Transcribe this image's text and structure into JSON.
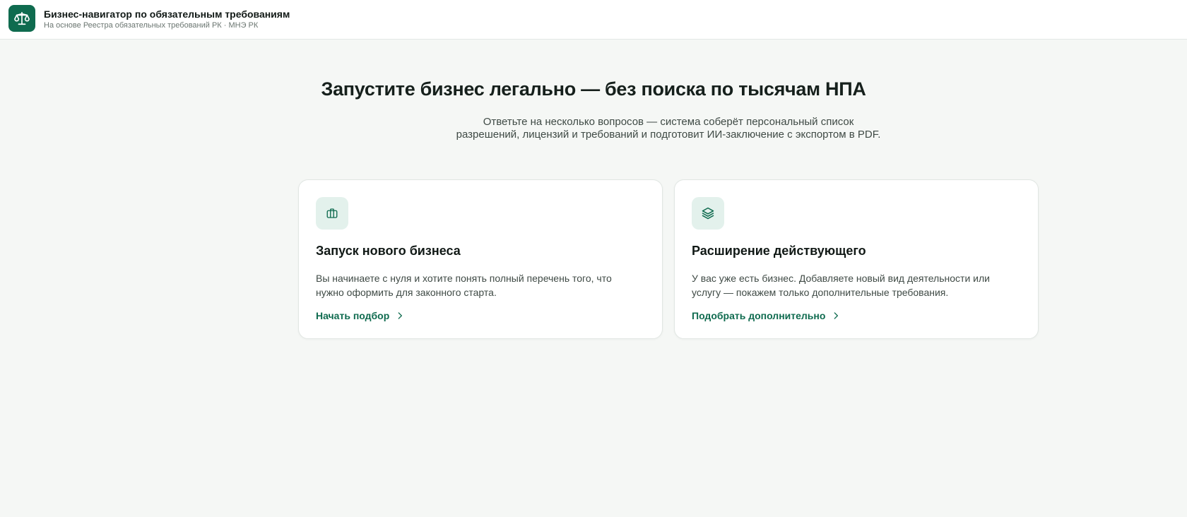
{
  "header": {
    "logo_icon": "scales-icon",
    "title": "Бизнес-навигатор по обязательным требованиям",
    "subtitle": "На основе Реестра обязательных требований РК · МНЭ РК"
  },
  "hero": {
    "title": "Запустите бизнес легально — без поиска по тысячам НПА",
    "text": "Ответьте на несколько вопросов — система соберёт персональный список разрешений, лицензий и требований и подготовит ИИ-заключение с экспортом в PDF."
  },
  "cards": [
    {
      "icon": "briefcase-icon",
      "title": "Запуск нового бизнеса",
      "description": "Вы начинаете с нуля и хотите понять полный перечень того, что нужно оформить для законного старта.",
      "link": "Начать подбор"
    },
    {
      "icon": "layers-icon",
      "title": "Расширение действующего",
      "description": "У вас уже есть бизнес. Добавляете новый вид деятельности или услугу — покажем только дополнительные требования.",
      "link": "Подобрать дополнительно"
    }
  ],
  "colors": {
    "brand": "#0f6b4f",
    "background": "#f5f7f5",
    "icon_tile": "#e3f1ec"
  }
}
